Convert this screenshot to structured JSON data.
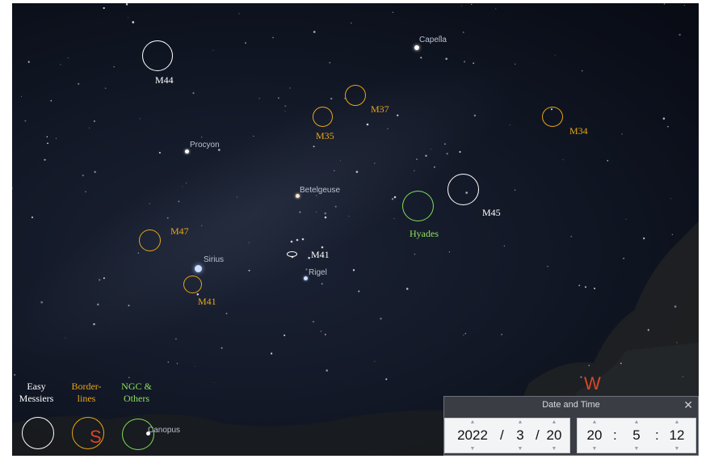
{
  "labels": {
    "m44": "M44",
    "m37": "M37",
    "m35": "M35",
    "m34": "M34",
    "m45": "M45",
    "hyades": "Hyades",
    "m47": "M47",
    "m41_white": "M41",
    "m41_orange": "M41"
  },
  "stars": {
    "capella": "Capella",
    "procyon": "Procyon",
    "betelgeuse": "Betelgeuse",
    "sirius": "Sirius",
    "rigel": "Rigel",
    "canopus": "Canopus"
  },
  "legend": {
    "easy_line1": "Easy",
    "easy_line2": "Messiers",
    "border_line1": "Border-",
    "border_line2": "lines",
    "ngc_line1": "NGC &",
    "ngc_line2": "Others"
  },
  "compass": {
    "west": "W",
    "south": "S"
  },
  "date_time": {
    "title": "Date and Time",
    "close": "✕",
    "year": "2022",
    "month": "3",
    "day": "20",
    "hour": "20",
    "minute": "5",
    "second": "12",
    "date_sep": "/",
    "time_sep": ":"
  },
  "colors": {
    "easy": "#ffffff",
    "borderline": "#e6a51a",
    "ngc": "#7fe05a",
    "compass": "#d8462a"
  }
}
